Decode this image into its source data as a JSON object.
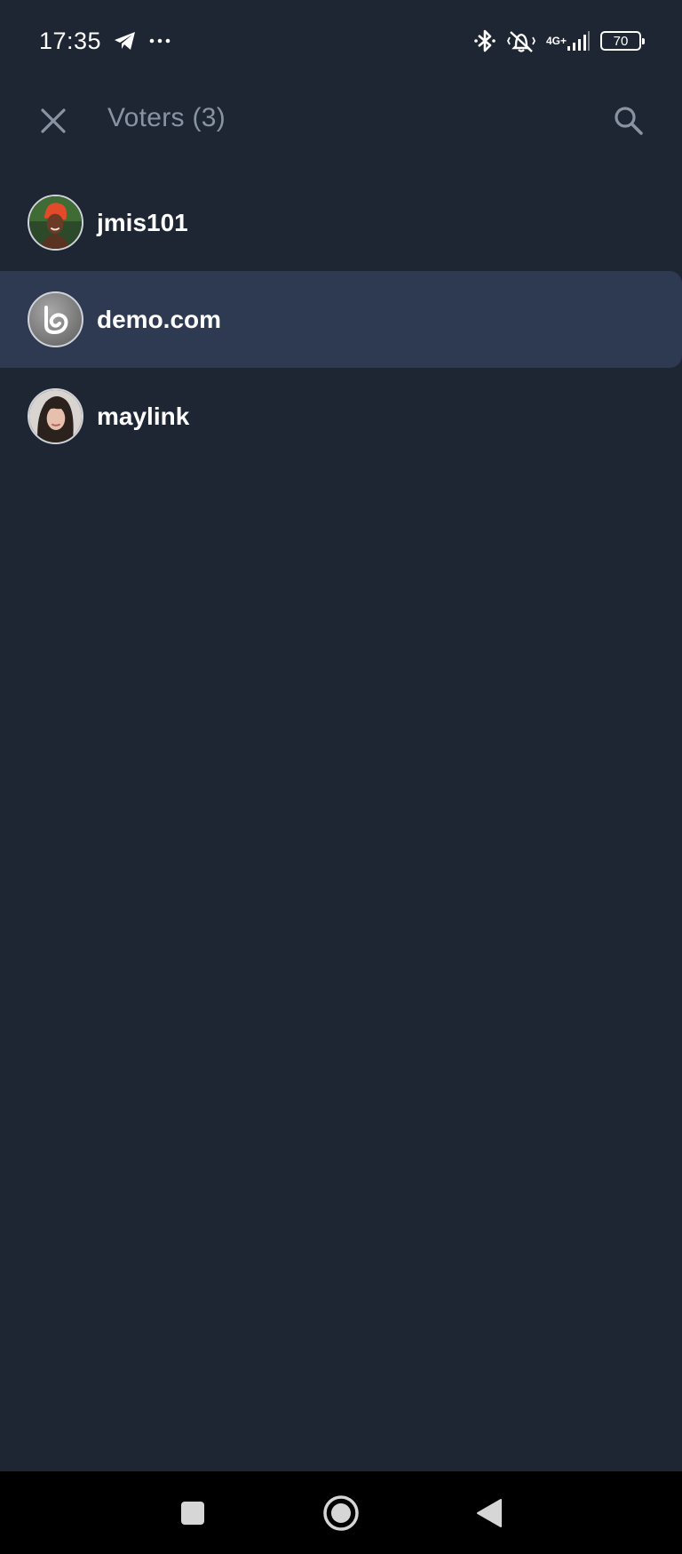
{
  "status_bar": {
    "time": "17:35",
    "network_top": "4G+",
    "network_bottom": "",
    "battery": "70",
    "icons": [
      "telegram-icon",
      "more-dots-icon",
      "bluetooth-icon",
      "vibrate-silent-icon",
      "signal-icon",
      "battery-icon"
    ]
  },
  "header": {
    "title": "Voters (3)",
    "close_icon": "close-icon",
    "search_icon": "search-icon",
    "title_color": "#8893a3"
  },
  "voters": [
    {
      "name": "jmis101",
      "selected": false,
      "avatar": "photo-avatar-red-headwrap"
    },
    {
      "name": "demo.com",
      "selected": true,
      "avatar": "logo-avatar"
    },
    {
      "name": "maylink",
      "selected": false,
      "avatar": "photo-avatar-portrait"
    }
  ],
  "nav_bar": {
    "icons": [
      "recents-square-icon",
      "home-circle-icon",
      "back-triangle-icon"
    ]
  },
  "colors": {
    "background": "#1f2633",
    "selected_row": "#2e3a52",
    "nav_background": "#000000"
  }
}
